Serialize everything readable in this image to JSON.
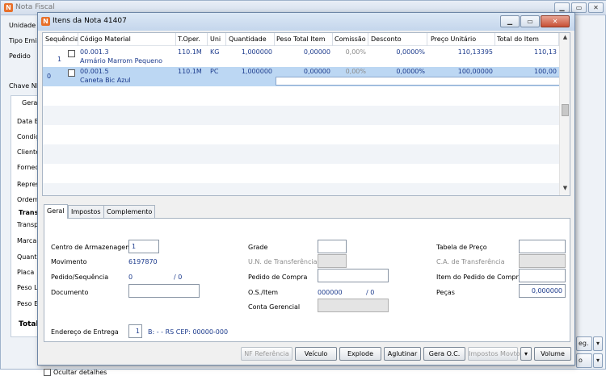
{
  "main_window": {
    "title": "Nota Fiscal",
    "labels": [
      "Unidade d",
      "Tipo Emis",
      "Pedido",
      "Chave NF",
      "Gera",
      "Data E",
      "Condiç",
      "Cliente",
      "Fornec",
      "Repres",
      "Ordem",
      "Trans",
      "Transp",
      "Marca",
      "Quanti",
      "Placa",
      "Peso L",
      "Peso E",
      "Total"
    ],
    "right_btn1": "eg.",
    "right_btn2": "o"
  },
  "dialog": {
    "title": "Itens da Nota 41407",
    "grid": {
      "headers": [
        "Sequência",
        "Código Material",
        "T.Oper.",
        "Uni",
        "Quantidade",
        "Peso Total Item",
        "Comissão",
        "Desconto",
        "Preço Unitário",
        "Total do Item"
      ],
      "rows": [
        {
          "seq": "1",
          "code": "00.001.3",
          "description": "Armário Marrom Pequeno",
          "toper": "110.1M",
          "uni": "KG",
          "quantidade": "1,000000",
          "peso": "0,00000",
          "comissao": "0,00%",
          "desconto": "0,0000%",
          "preco": "110,13395",
          "total": "110,13"
        },
        {
          "seq": "0",
          "code": "00.001.5",
          "description": "Caneta Bic Azul",
          "toper": "110.1M",
          "uni": "PC",
          "quantidade": "1,000000",
          "peso": "0,00000",
          "comissao": "0,00%",
          "desconto": "0,0000%",
          "preco": "100,00000",
          "total": "100,00"
        }
      ]
    },
    "tabs": [
      "Geral",
      "Impostos",
      "Complemento"
    ],
    "form": {
      "centro_label": "Centro de Armazenagem",
      "centro_value": "1",
      "movimento_label": "Movimento",
      "movimento_value": "6197870",
      "pedseq_label": "Pedido/Sequência",
      "pedseq_value1": "0",
      "pedseq_value2": "/ 0",
      "documento_label": "Documento",
      "documento_value": "",
      "grade_label": "Grade",
      "grade_value": "",
      "un_transf_label": "U.N. de Transferência",
      "pedido_compra_label": "Pedido de Compra",
      "pedido_compra_value": "",
      "os_item_label": "O.S./Item",
      "os_value1": "000000",
      "os_value2": "/ 0",
      "conta_label": "Conta Gerencial",
      "tabela_label": "Tabela de Preço",
      "tabela_value": "",
      "ca_transf_label": "C.A. de Transferência",
      "item_pedido_label": "Item do Pedido de Compra",
      "item_pedido_value": "",
      "pecas_label": "Peças",
      "pecas_value": "0,000000",
      "endereco_label": "Endereço de Entrega",
      "endereco_num": "1",
      "endereco_value": "B:  -  - RS CEP: 00000-000"
    },
    "footer": {
      "ocultar_label": "Ocultar detalhes",
      "buttons": {
        "nf_ref": "NF Referência",
        "veiculo": "Veículo",
        "explode": "Explode",
        "aglutinar": "Aglutinar",
        "gera_oc": "Gera O.C.",
        "impostos_movto": "Impostos Movto",
        "volume": "Volume"
      }
    }
  },
  "colors": {
    "selected_row": "#bcd7f3",
    "link_text": "#1b3a8c",
    "accent_title": "#c4d6ec"
  }
}
